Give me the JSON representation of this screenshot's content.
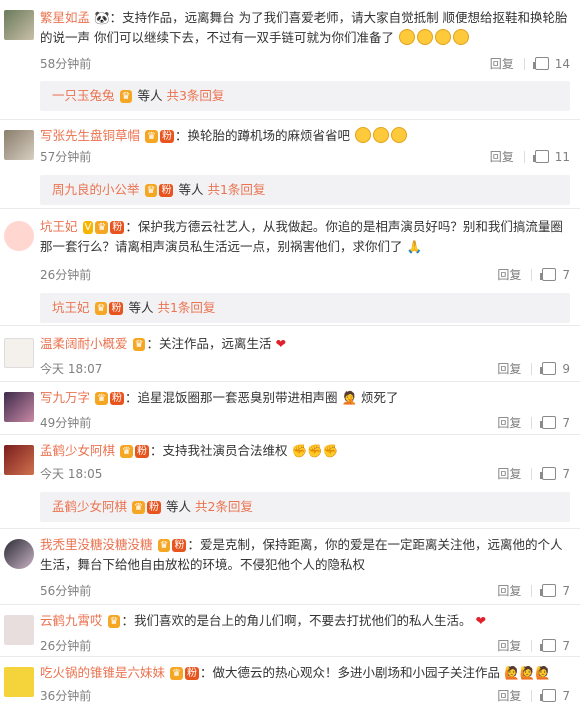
{
  "comments": [
    {
      "username": "繁星如孟",
      "text": "支持作品，远离舞台 为了我们喜爱老师，请大家自觉抵制 顺便想给抠鞋和换轮胎的说一声 你们可以继续下去，不过有一双手链可就为你们准备了",
      "time": "58分钟前",
      "reply": "回复",
      "likes": "14",
      "sub": {
        "who": "一只玉兔兔",
        "mid": "等人",
        "count": "共3条回复"
      }
    },
    {
      "username": "写张先生盘铜草帽",
      "text": "换轮胎的蹲机场的麻烦省省吧",
      "time": "57分钟前",
      "reply": "回复",
      "likes": "11",
      "sub": {
        "who": "周九良的小公举",
        "mid": "等人",
        "count": "共1条回复"
      }
    },
    {
      "username": "坑王妃",
      "text": "保护我方德云社艺人，从我做起。你追的是相声演员好吗？别和我们搞流量圈那一套行么？请离相声演员私生活远一点，别祸害他们，求你们了",
      "time": "26分钟前",
      "reply": "回复",
      "likes": "7",
      "sub": {
        "who": "坑王妃",
        "mid": "等人",
        "count": "共1条回复"
      }
    },
    {
      "username": "温柔阔耐小概爱",
      "text": "关注作品，远离生活",
      "time": "今天 18:07",
      "reply": "回复",
      "likes": "9"
    },
    {
      "username": "写九万字",
      "text": "追星混饭圈那一套恶臭别带进相声圈",
      "text2": "烦死了",
      "time": "49分钟前",
      "reply": "回复",
      "likes": "7"
    },
    {
      "username": "孟鹤少女阿棋",
      "text": "支持我社演员合法维权",
      "time": "今天 18:05",
      "reply": "回复",
      "likes": "7",
      "sub": {
        "who": "孟鹤少女阿棋",
        "mid": "等人",
        "count": "共2条回复"
      }
    },
    {
      "username": "我秃里没糖没糖没糖",
      "text": "爱是克制，保持距离，你的爱是在一定距离关注他，远离他的个人生活，舞台下给他自由放松的环境。不侵犯他个人的隐私权",
      "time": "56分钟前",
      "reply": "回复",
      "likes": "7"
    },
    {
      "username": "云鹤九霄哎",
      "text": "我们喜欢的是台上的角儿们啊，不要去打扰他们的私人生活。",
      "time": "26分钟前",
      "reply": "回复",
      "likes": "7"
    },
    {
      "username": "吃火锅的锥锥是六妹妹",
      "text": "做大德云的热心观众！多进小剧场和小园子关注作品",
      "time": "36分钟前",
      "reply": "回复",
      "likes": "7"
    }
  ],
  "colors": {
    "username": "#eb7350",
    "meta": "#808080",
    "subbg": "#f2f2f5"
  }
}
